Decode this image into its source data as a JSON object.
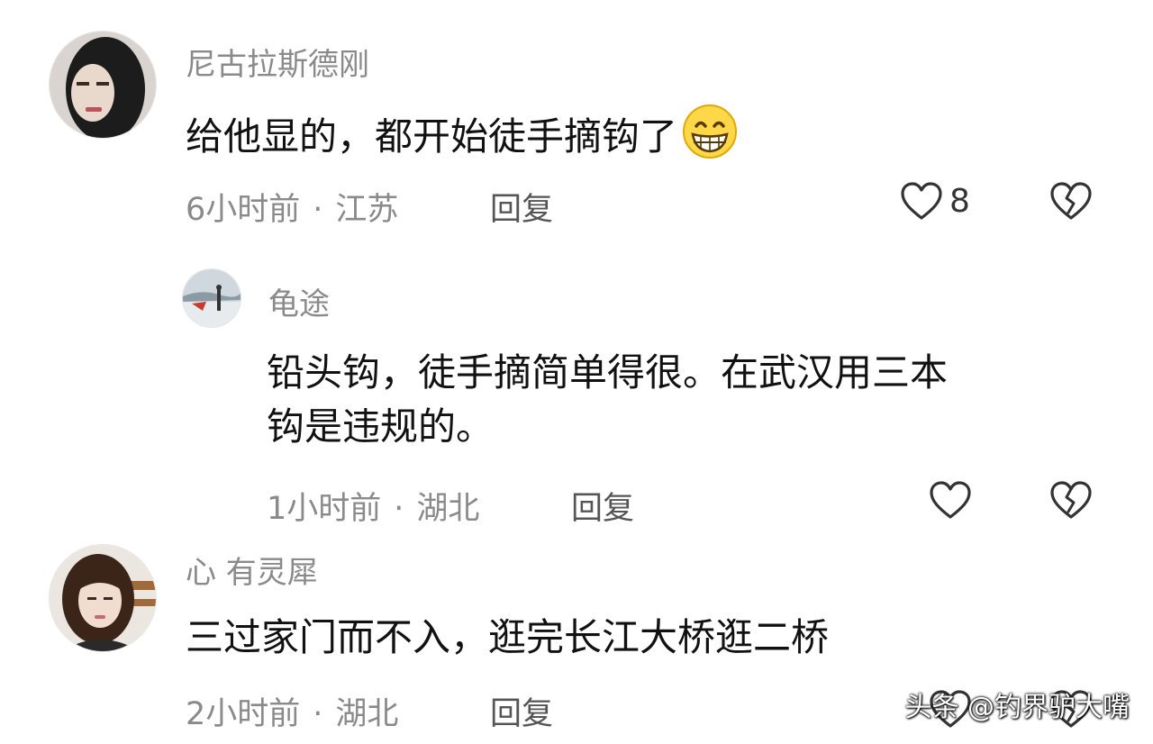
{
  "comments": [
    {
      "username": "尼古拉斯德刚",
      "text": "给他显的，都开始徒手摘钩了",
      "emoji": "grinning-face-emoji",
      "time": "6小时前",
      "location": "江苏",
      "reply_label": "回复",
      "like_count": "8"
    },
    {
      "username": "龟途",
      "text_line1": "铅头钩，徒手摘简单得很。在武汉用三本",
      "text_line2": "钩是违规的。",
      "time": "1小时前",
      "location": "湖北",
      "reply_label": "回复"
    },
    {
      "username": "心 有灵犀",
      "text": "三过家门而不入，逛完长江大桥逛二桥",
      "time": "2小时前",
      "location": "湖北",
      "reply_label": "回复"
    }
  ],
  "separator": "·",
  "watermark": "头条 @钓界驴大嘴",
  "icons": {
    "like": "heart-outline-icon",
    "dislike": "broken-heart-icon"
  },
  "colors": {
    "text": "#111111",
    "muted": "#8a8a8a",
    "icon": "#333333"
  }
}
